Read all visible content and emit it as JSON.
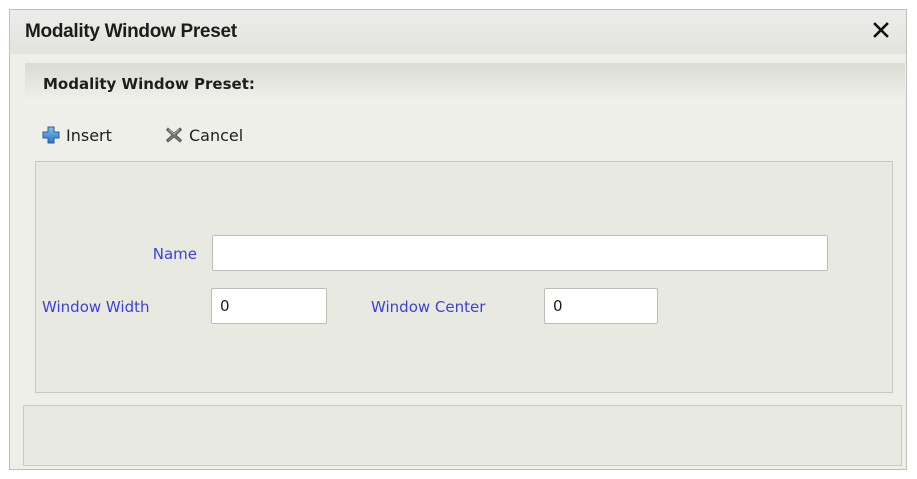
{
  "dialog": {
    "title": "Modality Window Preset",
    "close_icon": "close-x-icon"
  },
  "section": {
    "header": "Modality Window Preset:"
  },
  "toolbar": {
    "insert_label": "Insert",
    "insert_icon": "plus-icon",
    "cancel_label": "Cancel",
    "cancel_icon": "cancel-x-icon"
  },
  "form": {
    "name_label": "Name",
    "name_value": "",
    "window_width_label": "Window Width",
    "window_width_value": "0",
    "window_center_label": "Window Center",
    "window_center_value": "0"
  },
  "colors": {
    "label_color": "#3c3fe0",
    "icon_plus": "#3b8dd3",
    "icon_cancel": "#6a6a6a"
  }
}
